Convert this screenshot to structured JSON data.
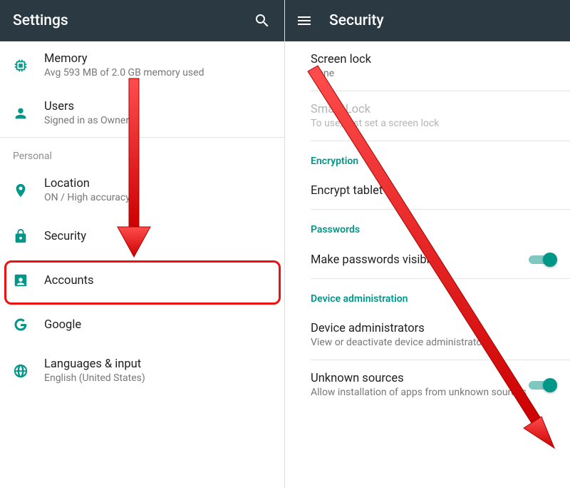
{
  "colors": {
    "accent": "#009688",
    "appbar": "#2b3a42",
    "highlight": "#ee1111"
  },
  "left": {
    "appbar": {
      "title": "Settings"
    },
    "items": [
      {
        "icon": "memory",
        "title": "Memory",
        "sub": "Avg 593 MB of 2.0 GB memory used"
      },
      {
        "icon": "user",
        "title": "Users",
        "sub": "Signed in as Owner"
      }
    ],
    "section": "Personal",
    "personal": [
      {
        "icon": "location",
        "title": "Location",
        "sub": "ON / High accuracy"
      },
      {
        "icon": "lock",
        "title": "Security",
        "sub": ""
      },
      {
        "icon": "account",
        "title": "Accounts",
        "sub": ""
      },
      {
        "icon": "google",
        "title": "Google",
        "sub": ""
      },
      {
        "icon": "globe",
        "title": "Languages & input",
        "sub": "English (United States)"
      }
    ]
  },
  "right": {
    "appbar": {
      "title": "Security"
    },
    "screen_lock": {
      "title": "Screen lock",
      "sub": "None"
    },
    "smart_lock": {
      "title": "Smart Lock",
      "sub": "To use, first set a screen lock"
    },
    "sec_encrypt": "Encryption",
    "encrypt": {
      "title": "Encrypt tablet"
    },
    "sec_pass": "Passwords",
    "make_visible": {
      "title": "Make passwords visible"
    },
    "sec_admin": "Device administration",
    "dev_admin": {
      "title": "Device administrators",
      "sub": "View or deactivate device administrators"
    },
    "unknown": {
      "title": "Unknown sources",
      "sub": "Allow installation of apps from unknown sources"
    }
  }
}
